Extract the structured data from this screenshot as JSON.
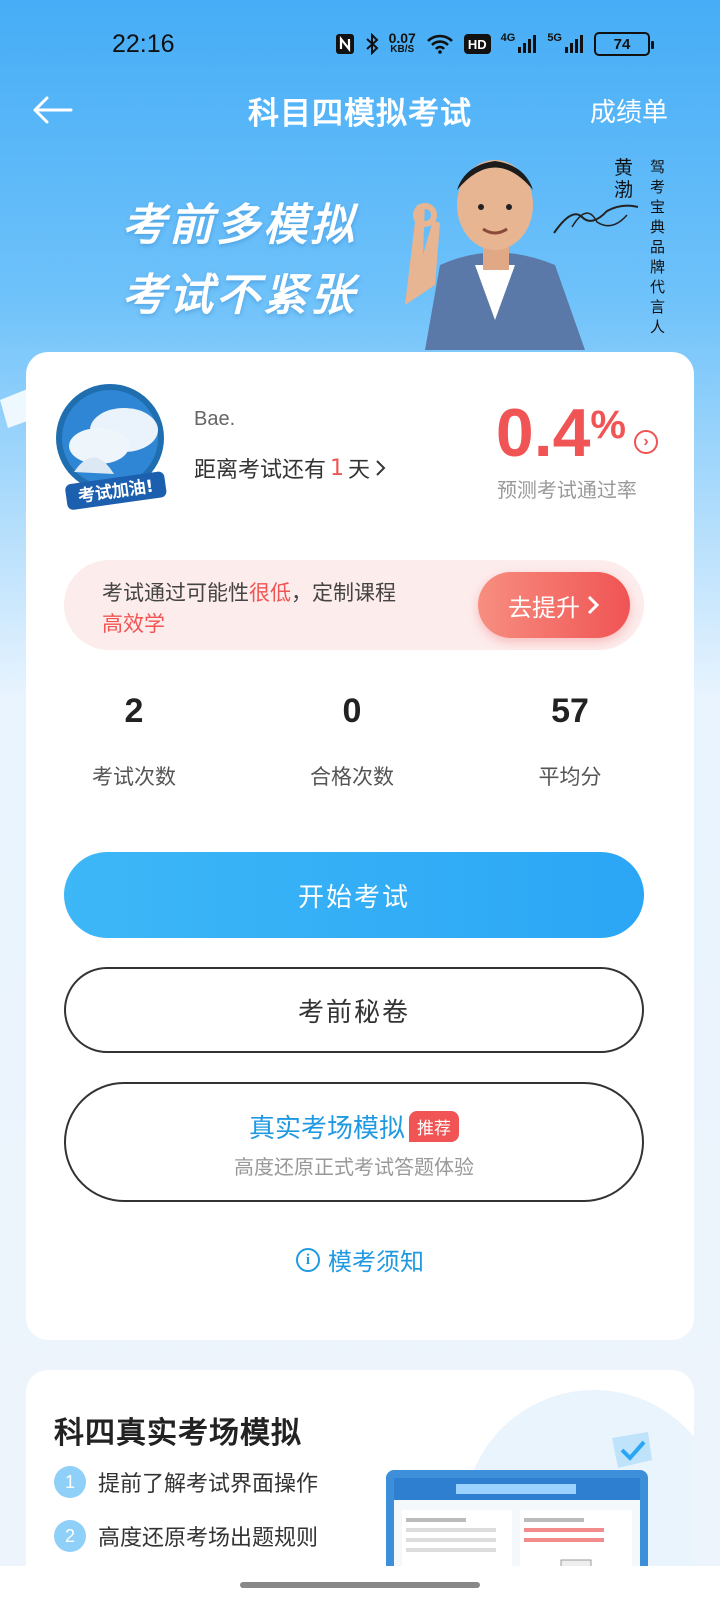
{
  "status_bar": {
    "time": "22:16",
    "net_speed_value": "0.07",
    "net_speed_unit": "KB/S",
    "hd_label": "HD",
    "signal1_label": "4G",
    "signal2_label": "5G",
    "battery": "74"
  },
  "nav": {
    "title": "科目四模拟考试",
    "right_link": "成绩单"
  },
  "banner": {
    "slogan_line1": "考前多模拟",
    "slogan_line2": "考试不紧张",
    "endorser_name": "黄渤",
    "endorser_title": "驾考宝典品牌代言人"
  },
  "profile": {
    "avatar_badge": "考试加油!",
    "user_name": "Bae.",
    "countdown_prefix": "距离考试还有",
    "countdown_days": "1",
    "countdown_suffix": "天",
    "pass_rate_value": "0.4",
    "pass_rate_unit": "%",
    "pass_rate_label": "预测考试通过率"
  },
  "improve": {
    "text_prefix": "考试通过可能性",
    "text_highlight": "很低",
    "text_middle": "，定制课程",
    "text_highlight2": "高效学",
    "button_label": "去提升"
  },
  "stats": [
    {
      "value": "2",
      "label": "考试次数"
    },
    {
      "value": "0",
      "label": "合格次数"
    },
    {
      "value": "57",
      "label": "平均分"
    }
  ],
  "actions": {
    "start_exam": "开始考试",
    "secret_paper": "考前秘卷",
    "real_sim_title": "真实考场模拟",
    "real_sim_tag": "推荐",
    "real_sim_subtitle": "高度还原正式考试答题体验",
    "notice": "模考须知"
  },
  "real_sim_section": {
    "title": "科四真实考场模拟",
    "features": [
      {
        "num": "1",
        "text": "提前了解考试界面操作"
      },
      {
        "num": "2",
        "text": "高度还原考场出题规则"
      }
    ]
  },
  "colors": {
    "primary_blue": "#2ba6f5",
    "accent_red": "#f05454",
    "link_blue": "#1f9ae2"
  }
}
